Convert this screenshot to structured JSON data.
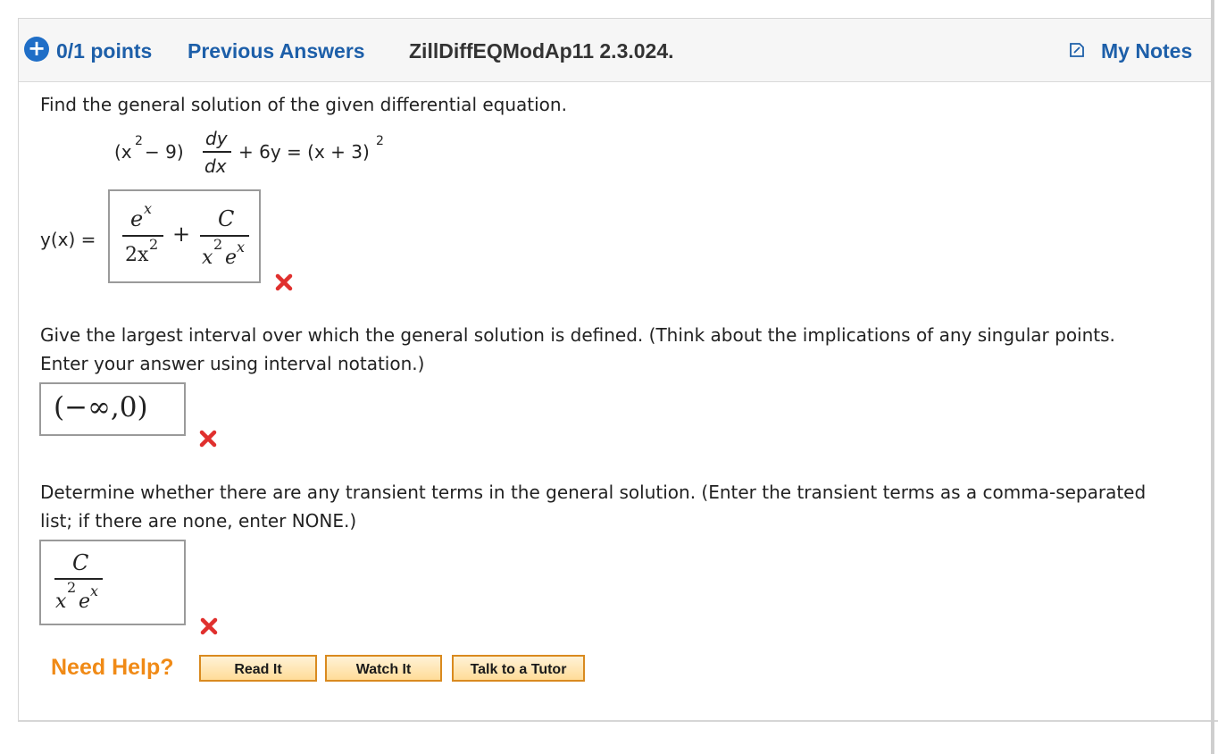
{
  "header": {
    "points": "0/1 points",
    "previous_answers": "Previous Answers",
    "problem_id": "ZillDiffEQModAp11 2.3.024.",
    "my_notes": "My Notes"
  },
  "question": {
    "prompt": "Find the general solution of the given differential equation.",
    "equation": {
      "lhs_open": "(x",
      "sq": "2",
      "lhs_mid": " − 9)",
      "dy": "dy",
      "dx": "dx",
      "rhs": "+ 6y = (x + 3)",
      "rhs_sq": "2"
    }
  },
  "answer1": {
    "label": "y(x) =",
    "num1": "e",
    "num1_sup": "x",
    "den1": "2x",
    "den1_sup": "2",
    "plus": "+",
    "num2": "C",
    "den2_x": "x",
    "den2_x_sup": "2",
    "den2_e": "e",
    "den2_e_sup": "x",
    "status": "incorrect"
  },
  "part2": {
    "prompt_line1": "Give the largest interval over which the general solution is defined. (Think about the implications of any singular points.",
    "prompt_line2": "Enter your answer using interval notation.)",
    "answer": "(−∞,0)",
    "status": "incorrect"
  },
  "part3": {
    "prompt_line1": "Determine whether there are any transient terms in the general solution. (Enter the transient terms as a comma-separated",
    "prompt_line2": "list; if there are none, enter NONE.)",
    "num": "C",
    "den_x": "x",
    "den_x_sup": "2",
    "den_e": "e",
    "den_e_sup": "x",
    "status": "incorrect"
  },
  "help": {
    "label": "Need Help?",
    "buttons": [
      "Read It",
      "Watch It",
      "Talk to a Tutor"
    ]
  },
  "colors": {
    "link_blue": "#1d5fa9",
    "incorrect_red": "#e0302e",
    "help_orange": "#f08a16"
  },
  "icons": [
    "plus-circle-icon",
    "note-icon",
    "x-mark-icon"
  ]
}
